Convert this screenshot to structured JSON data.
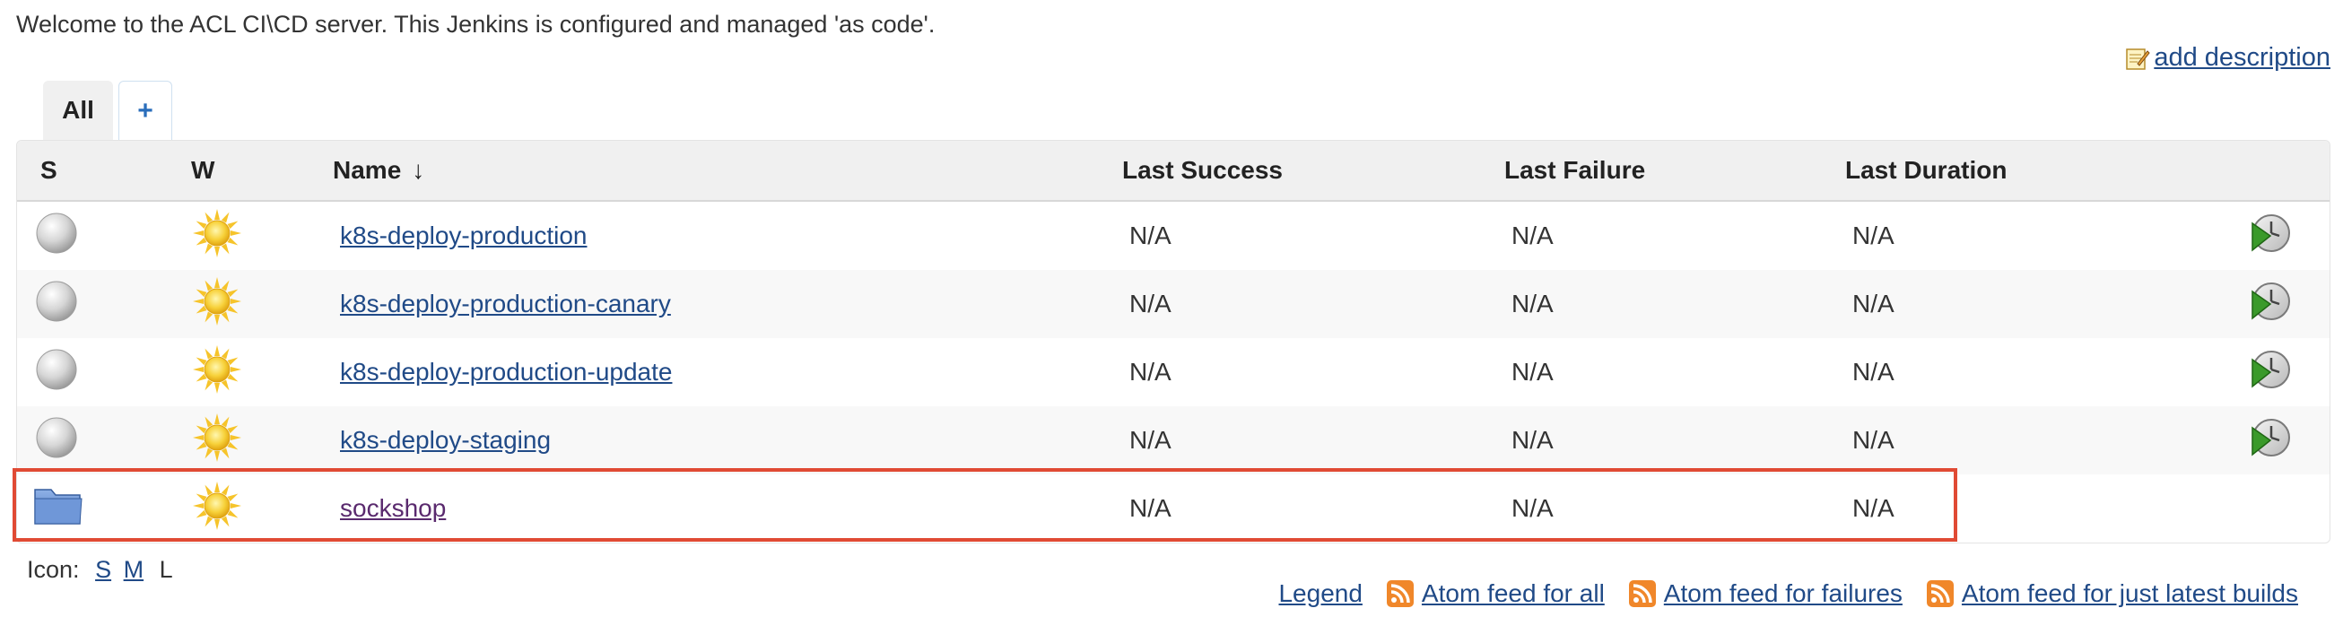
{
  "welcome": "Welcome to the ACL CI\\CD server.  This Jenkins is configured and managed 'as code'.",
  "add_description": "add description",
  "tabs": {
    "all": "All",
    "add": "+"
  },
  "columns": {
    "s": "S",
    "w": "W",
    "name": "Name",
    "sort_arrow": "↓",
    "last_success": "Last Success",
    "last_failure": "Last Failure",
    "last_duration": "Last Duration"
  },
  "jobs": [
    {
      "name": "k8s-deploy-production",
      "last_success": "N/A",
      "last_failure": "N/A",
      "last_duration": "N/A",
      "type": "pipeline",
      "health": "sunny"
    },
    {
      "name": "k8s-deploy-production-canary",
      "last_success": "N/A",
      "last_failure": "N/A",
      "last_duration": "N/A",
      "type": "pipeline",
      "health": "sunny"
    },
    {
      "name": "k8s-deploy-production-update",
      "last_success": "N/A",
      "last_failure": "N/A",
      "last_duration": "N/A",
      "type": "pipeline",
      "health": "sunny"
    },
    {
      "name": "k8s-deploy-staging",
      "last_success": "N/A",
      "last_failure": "N/A",
      "last_duration": "N/A",
      "type": "pipeline",
      "health": "sunny"
    },
    {
      "name": "sockshop",
      "last_success": "N/A",
      "last_failure": "N/A",
      "last_duration": "N/A",
      "type": "folder",
      "health": "sunny"
    }
  ],
  "icon_size": {
    "label": "Icon:",
    "s": "S",
    "m": "M",
    "l": "L"
  },
  "footer": {
    "legend": "Legend",
    "feed_all": "Atom feed for all",
    "feed_failures": "Atom feed for failures",
    "feed_latest": "Atom feed for just latest builds"
  },
  "colors": {
    "link": "#204a87",
    "visited_link": "#5a2a6e",
    "highlight": "#e04a34",
    "header_bg": "#f0f0f0",
    "rss": "#f0872a"
  }
}
